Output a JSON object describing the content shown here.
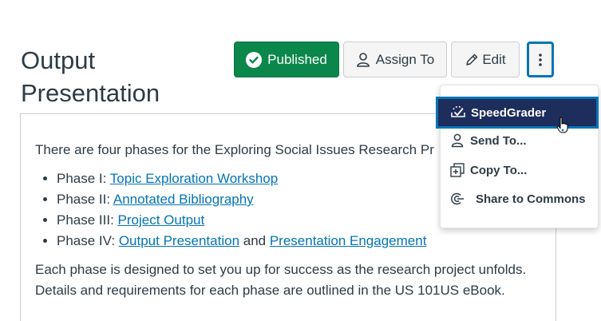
{
  "page": {
    "title": "Output Presentation"
  },
  "toolbar": {
    "published_label": "Published",
    "assign_label": "Assign To",
    "edit_label": "Edit"
  },
  "menu": {
    "items": [
      {
        "label": "SpeedGrader",
        "icon": "speedgrader-icon"
      },
      {
        "label": "Send To...",
        "icon": "user-icon"
      },
      {
        "label": "Copy To...",
        "icon": "copy-icon"
      },
      {
        "label": "Share to Commons",
        "icon": "commons-icon"
      }
    ]
  },
  "content": {
    "intro": "There are four phases for the Exploring Social Issues Research Project:",
    "phases": [
      {
        "prefix": "Phase I: ",
        "link": "Topic Exploration Workshop"
      },
      {
        "prefix": "Phase II: ",
        "link": "Annotated Bibliography"
      },
      {
        "prefix": "Phase III: ",
        "link": "Project Output"
      },
      {
        "prefix": "Phase IV: ",
        "link": "Output Presentation",
        "joiner": " and ",
        "link2": "Presentation Engagement"
      }
    ],
    "summary": "Each phase is designed to set you up for success as the research project unfolds. Details and requirements for each phase are outlined in the US 101US eBook."
  },
  "colors": {
    "published": "#0b874b",
    "link": "#0374b5",
    "focus": "#0374b5",
    "menu_active": "#1d2d5c"
  }
}
